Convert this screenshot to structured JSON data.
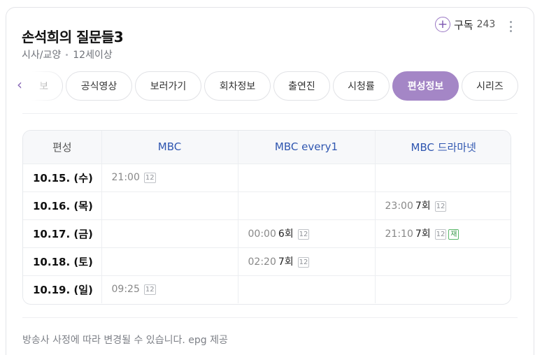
{
  "program": {
    "title": "손석희의 질문들3",
    "genre": "시사/교양",
    "rating": "12세이상"
  },
  "subscribe": {
    "plus_glyph": "+",
    "label": "구독",
    "count": "243"
  },
  "tabs": [
    {
      "label": "보",
      "active": false
    },
    {
      "label": "공식영상",
      "active": false
    },
    {
      "label": "보러가기",
      "active": false
    },
    {
      "label": "회차정보",
      "active": false
    },
    {
      "label": "출연진",
      "active": false
    },
    {
      "label": "시청률",
      "active": false
    },
    {
      "label": "편성정보",
      "active": true
    },
    {
      "label": "시리즈",
      "active": false
    }
  ],
  "prev_glyph": "‹",
  "schedule": {
    "corner_label": "편성",
    "channels": [
      "MBC",
      "MBC every1",
      "MBC 드라마넷"
    ],
    "rows": [
      {
        "date": "10.15. (수)",
        "cells": [
          {
            "time": "21:00",
            "episode": "",
            "rating": "12",
            "rerun": ""
          },
          {
            "time": "",
            "episode": "",
            "rating": "",
            "rerun": ""
          },
          {
            "time": "",
            "episode": "",
            "rating": "",
            "rerun": ""
          }
        ]
      },
      {
        "date": "10.16. (목)",
        "cells": [
          {
            "time": "",
            "episode": "",
            "rating": "",
            "rerun": ""
          },
          {
            "time": "",
            "episode": "",
            "rating": "",
            "rerun": ""
          },
          {
            "time": "23:00",
            "episode": "7회",
            "rating": "12",
            "rerun": ""
          }
        ]
      },
      {
        "date": "10.17. (금)",
        "cells": [
          {
            "time": "",
            "episode": "",
            "rating": "",
            "rerun": ""
          },
          {
            "time": "00:00",
            "episode": "6회",
            "rating": "12",
            "rerun": ""
          },
          {
            "time": "21:10",
            "episode": "7회",
            "rating": "12",
            "rerun": "재"
          }
        ]
      },
      {
        "date": "10.18. (토)",
        "cells": [
          {
            "time": "",
            "episode": "",
            "rating": "",
            "rerun": ""
          },
          {
            "time": "02:20",
            "episode": "7회",
            "rating": "12",
            "rerun": ""
          },
          {
            "time": "",
            "episode": "",
            "rating": "",
            "rerun": ""
          }
        ]
      },
      {
        "date": "10.19. (일)",
        "cells": [
          {
            "time": "09:25",
            "episode": "",
            "rating": "12",
            "rerun": ""
          },
          {
            "time": "",
            "episode": "",
            "rating": "",
            "rerun": ""
          },
          {
            "time": "",
            "episode": "",
            "rating": "",
            "rerun": ""
          }
        ]
      }
    ]
  },
  "footer_note": "방송사 사정에 따라 변경될 수 있습니다. epg 제공",
  "colors": {
    "accent": "#a486c6",
    "channel_text": "#2f56b0",
    "rerun_badge": "#3a9a4c"
  }
}
